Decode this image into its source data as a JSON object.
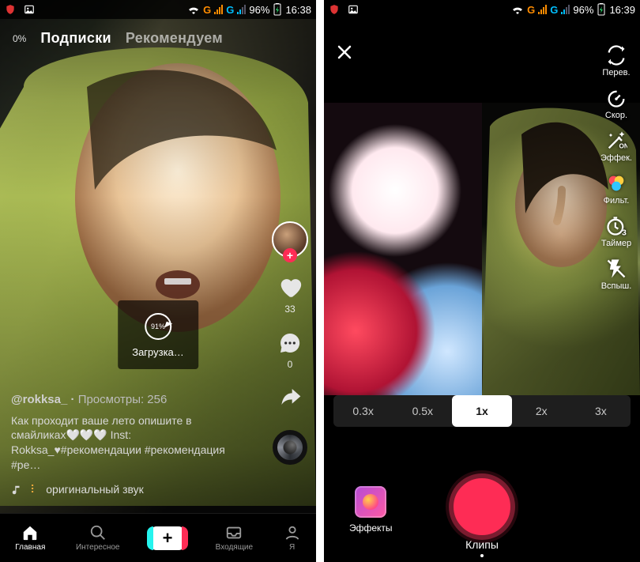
{
  "status": {
    "battery_pct": "96%",
    "time_left": "16:38",
    "time_right": "16:39",
    "net1": "G",
    "net2": "G"
  },
  "feed": {
    "live_pct": "0%",
    "tabs": {
      "following": "Подписки",
      "for_you": "Рекомендуем"
    },
    "loading": {
      "pct": "91%",
      "label": "Загрузка…"
    },
    "likes": "33",
    "comments": "0",
    "shares": "",
    "username": "@rokksa_",
    "views_label": "Просмотры: 256",
    "caption": "Как проходит ваше лето опишите в смайликах🤍🤍🤍   Inst: Rokksa_♥#рекомендации #рекомендация #ре…",
    "sound": "оригинальный звук",
    "tabbar": {
      "home": "Главная",
      "discover": "Интересное",
      "inbox": "Входящие",
      "me": "Я"
    }
  },
  "camera": {
    "tools": {
      "flip": "Перев.",
      "speed": "Скор.",
      "beauty": "Эффек.",
      "filters": "Фильт.",
      "timer": "Таймер",
      "timer_badge": "3",
      "flash": "Вспыш."
    },
    "speeds": [
      "0.3x",
      "0.5x",
      "1x",
      "2x",
      "3x"
    ],
    "speed_active_index": 2,
    "effects": "Эффекты",
    "mode": "Клипы"
  }
}
